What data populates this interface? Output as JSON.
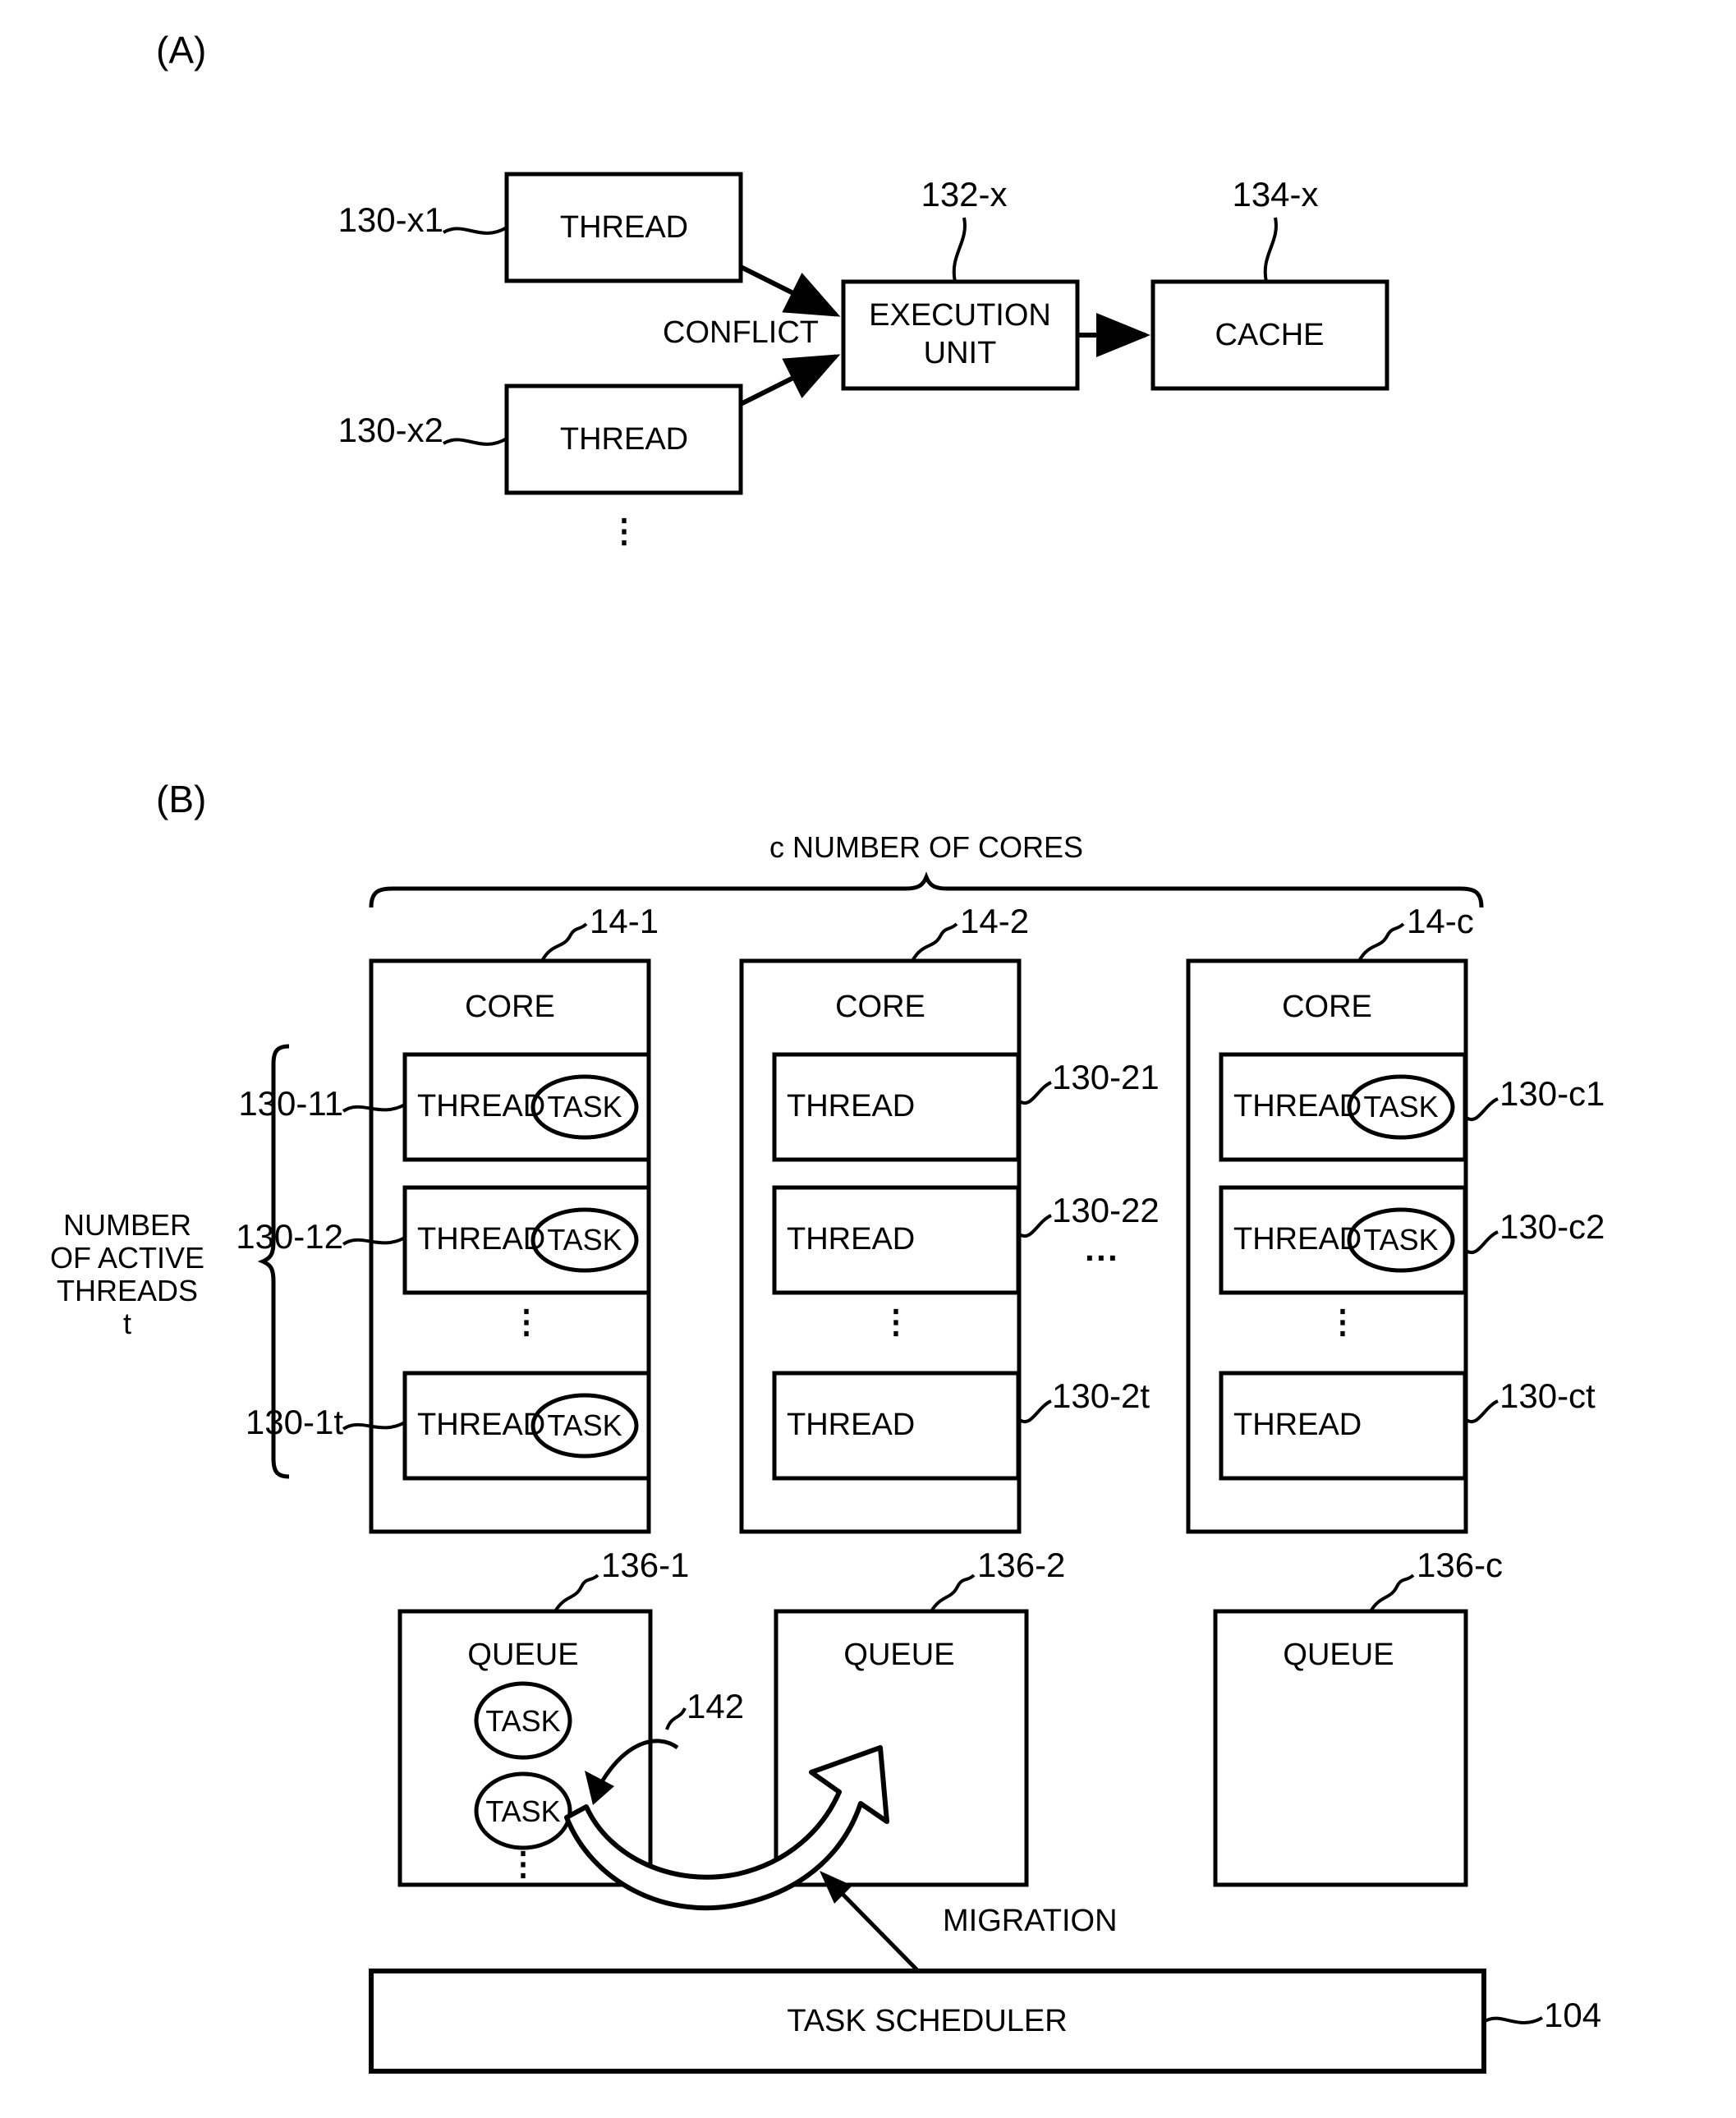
{
  "figure": {
    "panels": [
      {
        "letter": "(A)"
      },
      {
        "letter": "(B)"
      }
    ]
  },
  "panel_a": {
    "letter": "(A)",
    "thread_top": {
      "label": "THREAD",
      "ref": "130-x1"
    },
    "thread_bottom": {
      "label": "THREAD",
      "ref": "130-x2"
    },
    "conflict_label": "CONFLICT",
    "execution_unit": {
      "label_line1": "EXECUTION",
      "label_line2": "UNIT",
      "ref": "132-x"
    },
    "cache": {
      "label": "CACHE",
      "ref": "134-x"
    },
    "ellipsis": "⋮"
  },
  "panel_b": {
    "letter": "(B)",
    "cores_brace_label": "c NUMBER OF CORES",
    "threads_brace_label_line1": "NUMBER",
    "threads_brace_label_line2": "OF ACTIVE",
    "threads_brace_label_line3": "THREADS",
    "threads_brace_label_line4": "t",
    "horizontal_ellipsis": "···",
    "vertical_ellipsis": "⋮",
    "cores": [
      {
        "ref": "14-1",
        "label": "CORE",
        "threads": [
          {
            "label": "THREAD",
            "ref": "130-11",
            "task": "TASK",
            "has_task": true,
            "ref_side": "left"
          },
          {
            "label": "THREAD",
            "ref": "130-12",
            "task": "TASK",
            "has_task": true,
            "ref_side": "left"
          },
          {
            "label": "THREAD",
            "ref": "130-1t",
            "task": "TASK",
            "has_task": true,
            "ref_side": "left"
          }
        ]
      },
      {
        "ref": "14-2",
        "label": "CORE",
        "threads": [
          {
            "label": "THREAD",
            "ref": "130-21",
            "task": "",
            "has_task": false,
            "ref_side": "right"
          },
          {
            "label": "THREAD",
            "ref": "130-22",
            "task": "",
            "has_task": false,
            "ref_side": "right"
          },
          {
            "label": "THREAD",
            "ref": "130-2t",
            "task": "",
            "has_task": false,
            "ref_side": "right"
          }
        ]
      },
      {
        "ref": "14-c",
        "label": "CORE",
        "threads": [
          {
            "label": "THREAD",
            "ref": "130-c1",
            "task": "TASK",
            "has_task": true,
            "ref_side": "right"
          },
          {
            "label": "THREAD",
            "ref": "130-c2",
            "task": "TASK",
            "has_task": true,
            "ref_side": "right"
          },
          {
            "label": "THREAD",
            "ref": "130-ct",
            "task": "",
            "has_task": false,
            "ref_side": "right"
          }
        ]
      }
    ],
    "queues": [
      {
        "ref": "136-1",
        "label": "QUEUE",
        "tasks": [
          "TASK",
          "TASK"
        ],
        "ellipsis": "⋮"
      },
      {
        "ref": "136-2",
        "label": "QUEUE",
        "tasks": [],
        "ellipsis": ""
      },
      {
        "ref": "136-c",
        "label": "QUEUE",
        "tasks": [],
        "ellipsis": ""
      }
    ],
    "migration_arrow": {
      "ref": "142",
      "label": "MIGRATION"
    },
    "task_scheduler": {
      "label": "TASK SCHEDULER",
      "ref": "104"
    }
  }
}
